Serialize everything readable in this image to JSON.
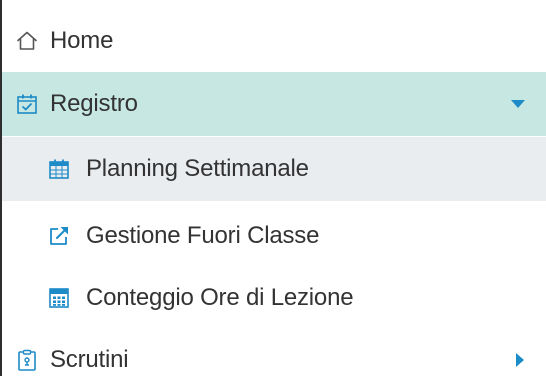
{
  "nav": {
    "items": [
      {
        "label": "Home",
        "icon": "home-icon"
      },
      {
        "label": "Registro",
        "icon": "calendar-check-icon",
        "expanded": true,
        "highlight_color": "#c7e7e3"
      },
      {
        "label": "Planning Settimanale",
        "icon": "calendar-icon",
        "selected": true,
        "highlight_color": "#e9edf0"
      },
      {
        "label": "Gestione Fuori Classe",
        "icon": "external-link-icon"
      },
      {
        "label": "Conteggio Ore di Lezione",
        "icon": "calculator-icon"
      },
      {
        "label": "Scrutini",
        "icon": "clipboard-icon",
        "expanded": false
      }
    ]
  },
  "colors": {
    "accent": "#1d8bc7",
    "text": "#333333",
    "active_bg": "#c7e7e3",
    "selected_bg": "#e9edf0"
  }
}
